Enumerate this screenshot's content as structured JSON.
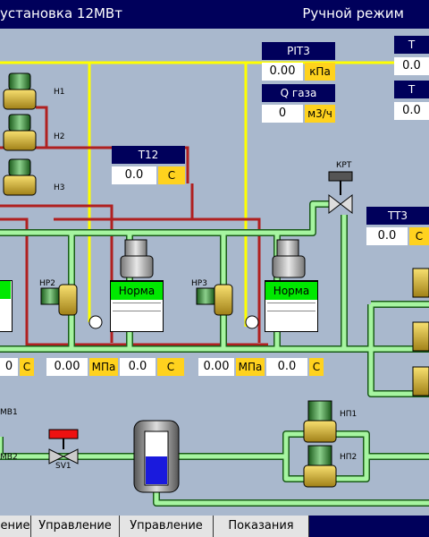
{
  "header": {
    "title": "установка 12МВт",
    "mode": "Ручной режим"
  },
  "panels": {
    "pit3": {
      "title": "PIT3",
      "value": "0.00",
      "unit": "кПа"
    },
    "qgas": {
      "title": "Q газа",
      "value": "0",
      "unit": "м3/ч"
    },
    "t12": {
      "title": "T12",
      "value": "0.0",
      "unit": "C"
    },
    "tt3": {
      "title": "TT3",
      "value": "0.0",
      "unit": "C"
    },
    "tr1": {
      "title": "T",
      "value": "0.0"
    },
    "tr2": {
      "title": "T",
      "value": "0.0"
    }
  },
  "readouts": {
    "r1": {
      "value": "0",
      "unit": "C"
    },
    "r2": {
      "value": "0.00",
      "unit": "МПа"
    },
    "r3": {
      "value": "0.0",
      "unit": "C"
    },
    "r4": {
      "value": "0.00",
      "unit": "МПа"
    },
    "r5": {
      "value": "0.0",
      "unit": "C"
    }
  },
  "labels": {
    "h1": "Н1",
    "h2": "Н2",
    "h3": "Н3",
    "krt": "КРТ",
    "hr2": "НР2",
    "hr3": "НР3",
    "mv1": "МВ1",
    "mv2": "МВ2",
    "sv1": "SV1",
    "np1": "НП1",
    "np2": "НП2"
  },
  "boilers": {
    "b1": "Норма",
    "b2": "Норма"
  },
  "footer": {
    "tabs": [
      "ение",
      "Управление",
      "Управление",
      "Показания",
      ""
    ]
  },
  "colors": {
    "header": "#00005b",
    "background": "#a9b8cd",
    "green_pipe": "#a6f5a0",
    "red_pipe": "#b02020",
    "yellow_pipe": "#ffff00",
    "status_ok": "#00e800",
    "unit_box": "#ffd21e"
  }
}
